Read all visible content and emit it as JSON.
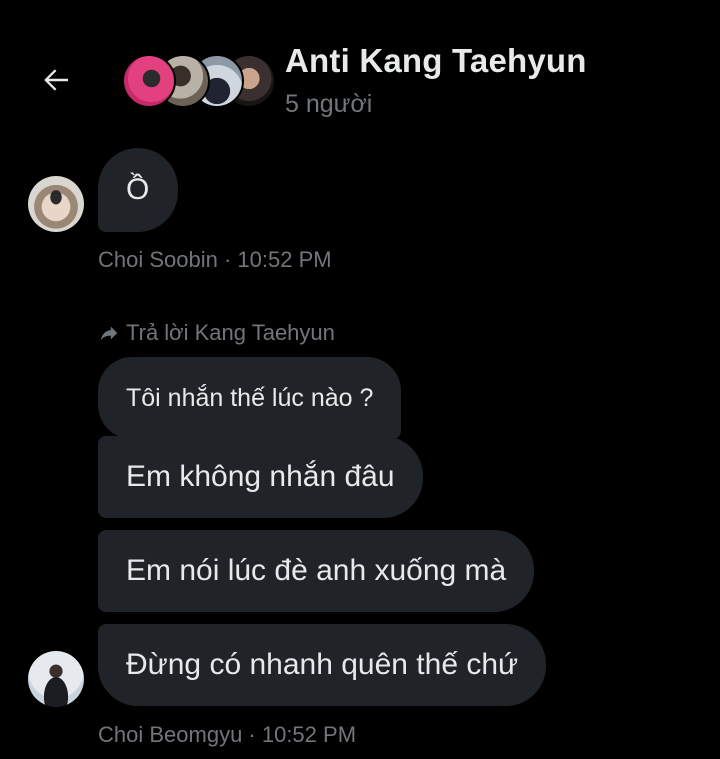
{
  "header": {
    "title": "Anti Kang Taehyun",
    "subtitle": "5 người",
    "back_icon": "arrow-left-icon"
  },
  "messages": [
    {
      "text": "Ồ",
      "sender": "Choi Soobin",
      "time": "10:52 PM"
    },
    {
      "reply_to": "Trả lời Kang Taehyun",
      "reply_icon": "reply-arrow-icon"
    },
    {
      "text": "Tôi nhắn thế lúc nào ?"
    },
    {
      "text": "Em không nhắn đâu"
    },
    {
      "text": "Em nói lúc đè anh xuống mà"
    },
    {
      "text": "Đừng có nhanh quên thế chứ",
      "sender": "Choi Beomgyu",
      "time": "10:52 PM"
    }
  ],
  "meta": {
    "soobin": "Choi Soobin · 10:52 PM",
    "beomgyu": "Choi Beomgyu · 10:52 PM"
  },
  "colors": {
    "background": "#000000",
    "bubble": "#202327",
    "text": "#e7e9ea",
    "muted": "#71767b"
  }
}
